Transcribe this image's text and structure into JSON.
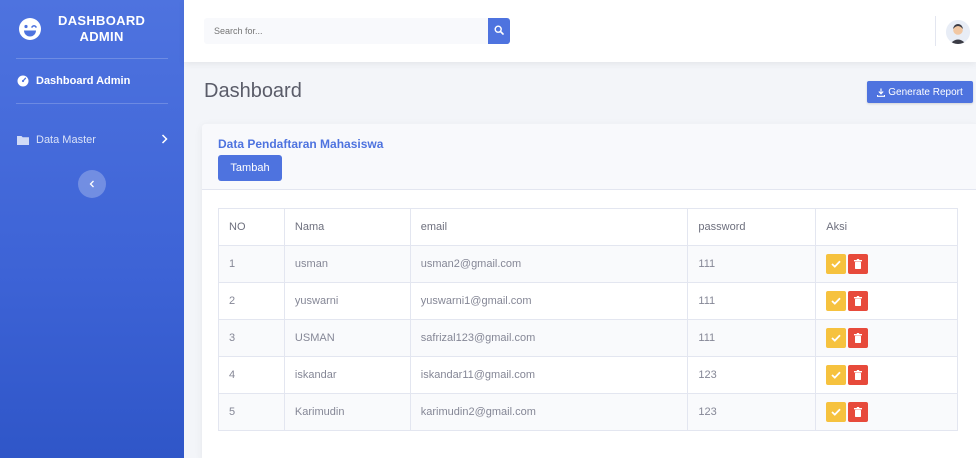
{
  "sidebar": {
    "brand_line1": "DASHBOARD",
    "brand_line2": "ADMIN",
    "brand_icon": "laugh-wink-icon",
    "items": [
      {
        "label": "Dashboard Admin",
        "icon": "tachometer-icon"
      },
      {
        "label": "Data Master",
        "icon": "folder-icon"
      }
    ]
  },
  "topbar": {
    "search_placeholder": "Search for..."
  },
  "page": {
    "title": "Dashboard",
    "report_button": "Generate Report"
  },
  "card": {
    "title": "Data Pendaftaran Mahasiswa",
    "add_button": "Tambah"
  },
  "table": {
    "headers": [
      "NO",
      "Nama",
      "email",
      "password",
      "Aksi"
    ],
    "rows": [
      {
        "no": "1",
        "nama": "usman",
        "email": "usman2@gmail.com",
        "password": "111"
      },
      {
        "no": "2",
        "nama": "yuswarni",
        "email": "yuswarni1@gmail.com",
        "password": "111"
      },
      {
        "no": "3",
        "nama": "USMAN",
        "email": "safrizal123@gmail.com",
        "password": "111"
      },
      {
        "no": "4",
        "nama": "iskandar",
        "email": "iskandar11@gmail.com",
        "password": "123"
      },
      {
        "no": "5",
        "nama": "Karimudin",
        "email": "karimudin2@gmail.com",
        "password": "123"
      }
    ]
  },
  "colors": {
    "primary": "#4e73df",
    "warning": "#f6c23e",
    "danger": "#e74a3b"
  }
}
